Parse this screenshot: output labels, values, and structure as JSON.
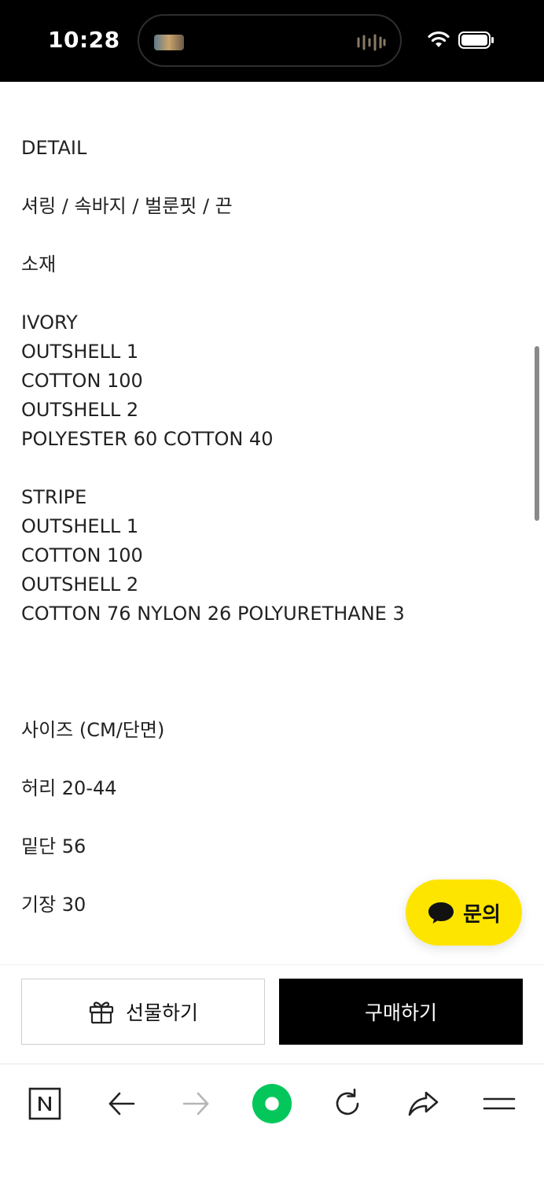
{
  "status_bar": {
    "time": "10:28"
  },
  "content": {
    "lines": [
      "DETAIL",
      "",
      "셔링 / 속바지 / 벌룬핏 / 끈",
      "",
      "소재",
      "",
      "IVORY",
      "OUTSHELL 1",
      "COTTON 100",
      "OUTSHELL 2",
      "POLYESTER 60 COTTON 40",
      "",
      "STRIPE",
      "OUTSHELL 1",
      "COTTON 100",
      "OUTSHELL 2",
      "COTTON 76 NYLON 26 POLYURETHANE 3",
      "",
      "",
      "",
      "사이즈 (CM/단면)",
      "",
      "허리 20-44",
      "",
      "밑단 56",
      "",
      "기장 30"
    ]
  },
  "inquiry_button": {
    "label": "문의",
    "icon": "chat-bubble-icon",
    "color": "#FEE500"
  },
  "action_bar": {
    "gift_label": "선물하기",
    "gift_icon": "gift-icon",
    "buy_label": "구매하기"
  },
  "browser_toolbar": {
    "items": [
      {
        "name": "naver-home",
        "icon": "naver-n-icon"
      },
      {
        "name": "back",
        "icon": "arrow-left-icon"
      },
      {
        "name": "forward",
        "icon": "arrow-right-icon"
      },
      {
        "name": "green-dot",
        "icon": "green-dot-icon",
        "color": "#03C75A"
      },
      {
        "name": "reload",
        "icon": "reload-icon"
      },
      {
        "name": "share",
        "icon": "share-icon"
      },
      {
        "name": "menu",
        "icon": "menu-icon"
      }
    ]
  }
}
